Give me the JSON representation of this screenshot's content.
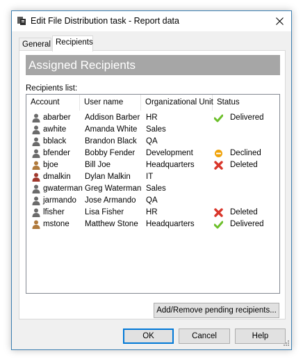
{
  "window": {
    "title": "Edit File Distribution task - Report data",
    "title_icon": "task-icon",
    "close_icon": "close-icon"
  },
  "tabs": [
    {
      "label": "General",
      "selected": false
    },
    {
      "label": "Recipients",
      "selected": true
    }
  ],
  "panel": {
    "banner": "Assigned Recipients",
    "list_label": "Recipients list:"
  },
  "columns": [
    "Account",
    "User name",
    "Organizational Unit",
    "Status"
  ],
  "rows": [
    {
      "account": "abarber",
      "user_name": "Addison Barber",
      "ou": "HR",
      "status": "Delivered",
      "status_icon": "check-icon",
      "user_icon_color": "#6b6b6b"
    },
    {
      "account": "awhite",
      "user_name": "Amanda White",
      "ou": "Sales",
      "status": "",
      "status_icon": "",
      "user_icon_color": "#6b6b6b"
    },
    {
      "account": "bblack",
      "user_name": "Brandon Black",
      "ou": "QA",
      "status": "",
      "status_icon": "",
      "user_icon_color": "#6b6b6b"
    },
    {
      "account": "bfender",
      "user_name": "Bobby Fender",
      "ou": "Development",
      "status": "Declined",
      "status_icon": "minus-icon",
      "user_icon_color": "#6b6b6b"
    },
    {
      "account": "bjoe",
      "user_name": "Bill Joe",
      "ou": "Headquarters",
      "status": "Deleted",
      "status_icon": "x-icon",
      "user_icon_color": "#b07a3c"
    },
    {
      "account": "dmalkin",
      "user_name": "Dylan Malkin",
      "ou": "IT",
      "status": "",
      "status_icon": "",
      "user_icon_color": "#a0382c"
    },
    {
      "account": "gwaterman",
      "user_name": "Greg Waterman",
      "ou": "Sales",
      "status": "",
      "status_icon": "",
      "user_icon_color": "#6b6b6b"
    },
    {
      "account": "jarmando",
      "user_name": "Jose Armando",
      "ou": "QA",
      "status": "",
      "status_icon": "",
      "user_icon_color": "#6b6b6b"
    },
    {
      "account": "lfisher",
      "user_name": "Lisa Fisher",
      "ou": "HR",
      "status": "Deleted",
      "status_icon": "x-icon",
      "user_icon_color": "#6b6b6b"
    },
    {
      "account": "mstone",
      "user_name": "Matthew Stone",
      "ou": "Headquarters",
      "status": "Delivered",
      "status_icon": "check-icon",
      "user_icon_color": "#b07a3c"
    }
  ],
  "buttons": {
    "add_remove": "Add/Remove pending recipients...",
    "ok": "OK",
    "cancel": "Cancel",
    "help": "Help"
  },
  "colors": {
    "check": "#6cbf2a",
    "declined": "#f0a30a",
    "deleted": "#d9362b",
    "banner_bg": "#a6a6a6",
    "focus_border": "#0078d7"
  }
}
